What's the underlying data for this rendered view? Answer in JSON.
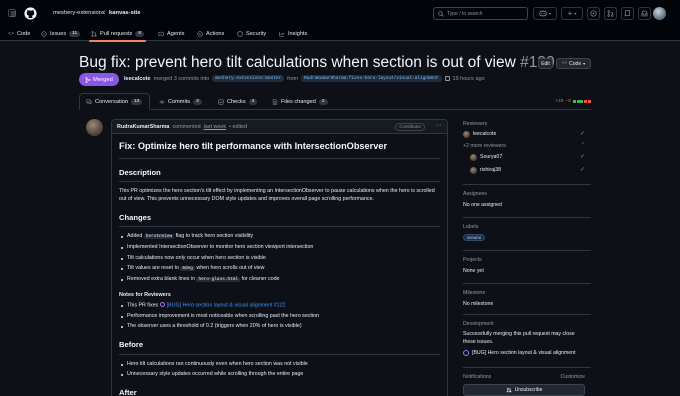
{
  "header": {
    "org": "meshery-extensions",
    "repo": "kanvas-site",
    "search_placeholder": "Type / to search"
  },
  "repo_tabs": [
    {
      "label": "Code",
      "count": ""
    },
    {
      "label": "Issues",
      "count": "11"
    },
    {
      "label": "Pull requests",
      "count": "8"
    },
    {
      "label": "Agents",
      "count": ""
    },
    {
      "label": "Actions",
      "count": ""
    },
    {
      "label": "Security",
      "count": ""
    },
    {
      "label": "Insights",
      "count": ""
    }
  ],
  "pr": {
    "title": "Bug fix: prevent hero tilt calculations when section is out of view",
    "number": "#130",
    "edit_label": "Edit",
    "code_label": "Code",
    "state": "Merged",
    "merged_by": "leecalcote",
    "merged_text": "merged 3 commits into",
    "base_branch": "meshery-extensions:master",
    "from_text": "from",
    "head_branch": "RudraKumarSharma:fixes-hero-layout/visual-alignment",
    "time": "19 hours ago"
  },
  "pr_tabs": [
    {
      "label": "Conversation",
      "count": "13"
    },
    {
      "label": "Commits",
      "count": "3"
    },
    {
      "label": "Checks",
      "count": "4"
    },
    {
      "label": "Files changed",
      "count": "2"
    }
  ],
  "diffstat": {
    "added": "+18",
    "removed": "−8"
  },
  "comment": {
    "author": "RudraKumarSharma",
    "action": "commented",
    "when": "last week",
    "edited": "• edited",
    "role": "Contributor",
    "heading": "Fix: Optimize hero tilt performance with IntersectionObserver",
    "description_title": "Description",
    "description": "This PR optimizes the hero section's tilt effect by implementing an IntersectionObserver to pause calculations when the hero is scrolled out of view. This prevents unnecessary DOM style updates and improves overall page scrolling performance.",
    "changes_title": "Changes",
    "changes": [
      {
        "pre": "Added ",
        "code": "heroInView",
        "post": " flag to track hero section visibility"
      },
      {
        "pre": "Implemented IntersectionObserver to monitor hero section viewport intersection",
        "code": "",
        "post": ""
      },
      {
        "pre": "Tilt calculations now only occur when hero section is visible",
        "code": "",
        "post": ""
      },
      {
        "pre": "Tilt values are reset to ",
        "code": "0deg",
        "post": " when hero scrolls out of view"
      },
      {
        "pre": "Removed extra blank lines in ",
        "code": "hero-glass.html",
        "post": " for cleaner code"
      }
    ],
    "notes_title": "Notes for Reviewers",
    "notes": [
      {
        "pre": "This PR fixes ",
        "link": "[BUG] Hero section layout & visual alignment #122"
      },
      {
        "pre": "Performance improvement is most noticeable when scrolling past the hero section",
        "link": ""
      },
      {
        "pre": "The observer uses a threshold of 0.2 (triggers when 20% of hero is visible)",
        "link": ""
      }
    ],
    "before_title": "Before",
    "before": [
      "Hero tilt calculations ran continuously even when hero section was not visible",
      "Unnecessary style updates occurred while scrolling through the entire page"
    ],
    "after_title": "After"
  },
  "sidebar": {
    "reviewers_title": "Reviewers",
    "reviewer_main": "leecalcote",
    "more_reviewers": "+2 more reviewers",
    "reviewers_more": [
      "Sourya07",
      "rishiraj38"
    ],
    "assignees_title": "Assignees",
    "assignees_value": "No one assigned",
    "labels_title": "Labels",
    "label": "area/ui",
    "projects_title": "Projects",
    "projects_value": "None yet",
    "milestone_title": "Milestone",
    "milestone_value": "No milestone",
    "development_title": "Development",
    "development_text": "Successfully merging this pull request may close these issues.",
    "development_issue": "[BUG] Hero section layout & visual alignment",
    "notifications_title": "Notifications",
    "customize": "Customize",
    "unsubscribe": "Unsubscribe"
  }
}
